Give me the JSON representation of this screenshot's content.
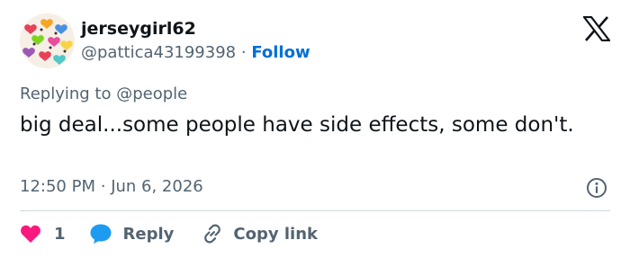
{
  "user": {
    "display_name": "jerseygirl62",
    "handle": "@pattica43199398",
    "separator": "·",
    "follow_label": "Follow"
  },
  "reply_context": {
    "prefix": "Replying to",
    "mention": "@people"
  },
  "tweet": {
    "text": "big deal...some people have side effects, some don't.",
    "time": "12:50 PM",
    "separator": "·",
    "date": "Jun 6, 2026"
  },
  "actions": {
    "like_count": "1",
    "reply_label": "Reply",
    "copy_label": "Copy link"
  },
  "icons": {
    "brand": "x-logo-icon",
    "info": "info-icon",
    "like": "heart-icon",
    "reply": "speech-bubble-icon",
    "copy": "link-icon"
  },
  "colors": {
    "like": "#f91880",
    "reply": "#1d9bf0",
    "follow": "#006fd6",
    "secondary_text": "#536471",
    "divider": "#cfd9de"
  }
}
